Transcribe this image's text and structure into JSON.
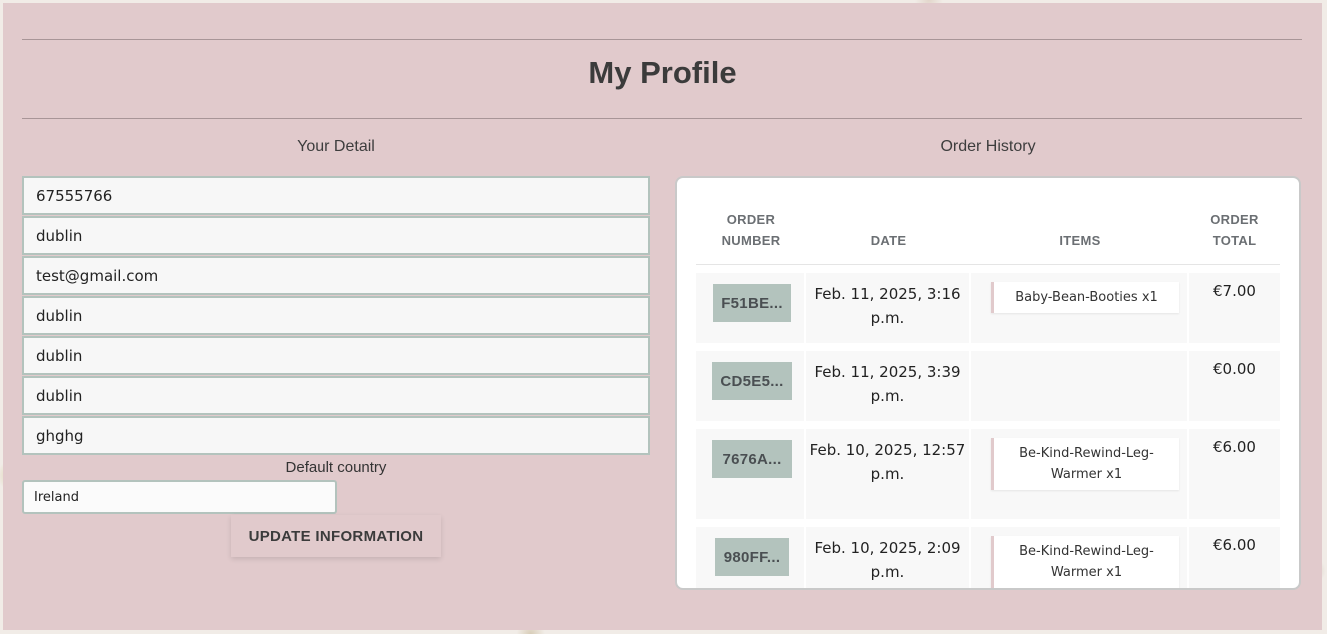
{
  "page": {
    "title": "My Profile"
  },
  "details": {
    "heading": "Your Detail",
    "fields": [
      "67555766",
      "dublin",
      "test@gmail.com",
      "dublin",
      "dublin",
      "dublin",
      "ghghg"
    ],
    "country_label": "Default country",
    "country_value": "Ireland",
    "update_label": "UPDATE INFORMATION"
  },
  "orders": {
    "heading": "Order History",
    "columns": [
      "ORDER\nNUMBER",
      "DATE",
      "ITEMS",
      "ORDER\nTOTAL"
    ],
    "rows": [
      {
        "number": "F51BE...",
        "date": "Feb. 11, 2025, 3:16\np.m.",
        "items": "Baby-Bean-Booties x1",
        "total": "€7.00"
      },
      {
        "number": "CD5E5...",
        "date": "Feb. 11, 2025, 3:39\np.m.",
        "items": "",
        "total": "€0.00"
      },
      {
        "number": "7676A...",
        "date": "Feb. 10, 2025, 12:57\np.m.",
        "items": "Be-Kind-Rewind-Leg-\nWarmer x1",
        "total": "€6.00"
      },
      {
        "number": "980FF...",
        "date": "Feb. 10, 2025, 2:09\np.m.",
        "items": "Be-Kind-Rewind-Leg-\nWarmer x1",
        "total": "€6.00"
      }
    ]
  }
}
